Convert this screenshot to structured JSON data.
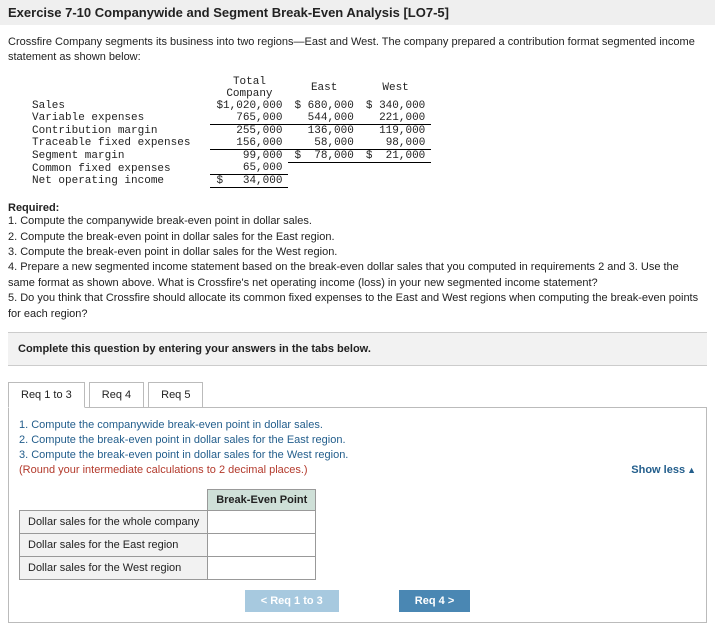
{
  "title": "Exercise 7-10 Companywide and Segment Break-Even Analysis [LO7-5]",
  "intro": "Crossfire Company segments its business into two regions—East and West. The company prepared a contribution format segmented income statement as shown below:",
  "income": {
    "cols": {
      "c0": "Total Company",
      "c1": "East",
      "c2": "West"
    },
    "rows": [
      {
        "label": "Sales",
        "c0": "$1,020,000",
        "c1": "$ 680,000",
        "c2": "$ 340,000"
      },
      {
        "label": "Variable expenses",
        "c0": "765,000",
        "c1": "544,000",
        "c2": "221,000"
      },
      {
        "label": "Contribution margin",
        "c0": "255,000",
        "c1": "136,000",
        "c2": "119,000"
      },
      {
        "label": "Traceable fixed expenses",
        "c0": "156,000",
        "c1": "58,000",
        "c2": "98,000"
      },
      {
        "label": "Segment margin",
        "c0": "99,000",
        "c1": "$  78,000",
        "c2": "$  21,000"
      },
      {
        "label": "Common fixed expenses",
        "c0": "65,000",
        "c1": "",
        "c2": ""
      },
      {
        "label": "Net operating income",
        "c0": "$   34,000",
        "c1": "",
        "c2": ""
      }
    ]
  },
  "required_h": "Required:",
  "required": "1. Compute the companywide break-even point in dollar sales.\n2. Compute the break-even point in dollar sales for the East region.\n3. Compute the break-even point in dollar sales for the West region.\n4. Prepare a new segmented income statement based on the break-even dollar sales that you computed in requirements 2 and 3. Use the same format as shown above. What is Crossfire's net operating income (loss) in your new segmented income statement?\n5. Do you think that Crossfire should allocate its common fixed expenses to the East and West regions when computing the break-even points for each region?",
  "instr_box": "Complete this question by entering your answers in the tabs below.",
  "tabs": {
    "t1": "Req 1 to 3",
    "t2": "Req 4",
    "t3": "Req 5"
  },
  "tab_content": {
    "line1": "1. Compute the companywide break-even point in dollar sales.",
    "line2": "2. Compute the break-even point in dollar sales for the East region.",
    "line3": "3. Compute the break-even point in dollar sales for the West region.",
    "round": "(Round your intermediate calculations to 2 decimal places.)"
  },
  "show_less": "Show less",
  "answer": {
    "header": "Break-Even Point",
    "rows": {
      "r1": "Dollar sales for the whole company",
      "r2": "Dollar sales for the East region",
      "r3": "Dollar sales for the West region"
    }
  },
  "nav": {
    "prev": "Req 1 to 3",
    "next": "Req 4"
  }
}
